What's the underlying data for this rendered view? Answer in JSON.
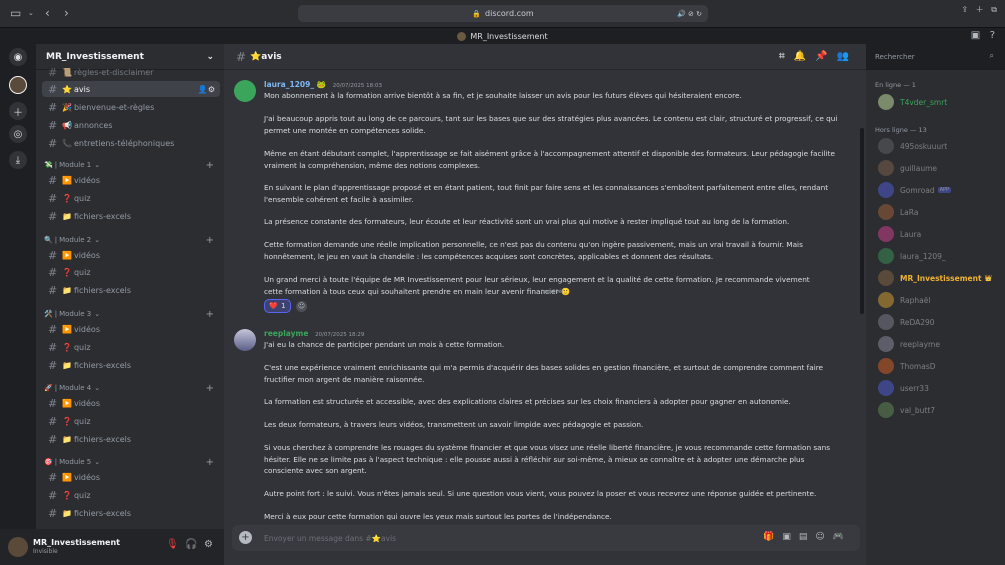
{
  "browser": {
    "url": "discord.com"
  },
  "window_title": "MR_Investissement",
  "sidebar": {
    "guild_name": "MR_Investissement",
    "top_channels": [
      {
        "emoji": "📜",
        "label": "règles-et-disclaimer"
      },
      {
        "emoji": "⭐",
        "label": "avis",
        "active": true
      },
      {
        "emoji": "🎉",
        "label": "bienvenue-et-règles"
      },
      {
        "emoji": "📢",
        "label": "annonces"
      },
      {
        "emoji": "📞",
        "label": "entretiens-téléphoniques"
      }
    ],
    "modules": [
      {
        "emoji": "💸",
        "label": "Module 1",
        "channels": [
          {
            "emoji": "▶️",
            "label": "vidéos"
          },
          {
            "emoji": "❓",
            "label": "quiz"
          },
          {
            "emoji": "📁",
            "label": "fichiers-excels"
          }
        ]
      },
      {
        "emoji": "🔍",
        "label": "Module 2",
        "channels": [
          {
            "emoji": "▶️",
            "label": "vidéos"
          },
          {
            "emoji": "❓",
            "label": "quiz"
          },
          {
            "emoji": "📁",
            "label": "fichiers-excels"
          }
        ]
      },
      {
        "emoji": "🛠️",
        "label": "Module 3",
        "channels": [
          {
            "emoji": "▶️",
            "label": "vidéos"
          },
          {
            "emoji": "❓",
            "label": "quiz"
          },
          {
            "emoji": "📁",
            "label": "fichiers-excels"
          }
        ]
      },
      {
        "emoji": "🚀",
        "label": "Module 4",
        "channels": [
          {
            "emoji": "▶️",
            "label": "vidéos"
          },
          {
            "emoji": "❓",
            "label": "quiz"
          },
          {
            "emoji": "📁",
            "label": "fichiers-excels"
          }
        ]
      },
      {
        "emoji": "🎯",
        "label": "Module 5",
        "channels": [
          {
            "emoji": "▶️",
            "label": "vidéos"
          },
          {
            "emoji": "❓",
            "label": "quiz"
          },
          {
            "emoji": "📁",
            "label": "fichiers-excels"
          }
        ]
      }
    ]
  },
  "user_panel": {
    "name": "MR_Investissement",
    "status": "Invisible"
  },
  "chat": {
    "channel_name": "⭐avis",
    "search_placeholder": "Rechercher",
    "messages": [
      {
        "author": "laura_1209_",
        "badge": "🐸",
        "timestamp": "20/07/2025 18:03",
        "author_color": "#7fb8f5",
        "paragraphs": [
          "Mon abonnement à la formation arrive bientôt à sa fin, et je souhaite laisser un avis pour les futurs élèves qui hésiteraient encore.",
          "J'ai beaucoup appris tout au long de ce parcours, tant sur les bases que sur des stratégies plus avancées. Le contenu est clair, structuré et progressif, ce qui permet une montée en compétences solide.",
          "Même en étant débutant complet, l'apprentissage se fait aisément grâce à l'accompagnement attentif et disponible des formateurs. Leur pédagogie facilite vraiment la compréhension, même des notions complexes.",
          "En suivant le plan d'apprentissage proposé et en étant patient, tout finit par faire sens et les connaissances s'emboîtent parfaitement entre elles, rendant l'ensemble cohérent et facile à assimiler.",
          "La présence constante des formateurs, leur écoute et leur réactivité sont un vrai plus qui motive à rester impliqué tout au long de la formation.",
          "Cette formation demande une réelle implication personnelle, ce n'est pas du contenu qu'on ingère passivement, mais un vrai travail à fournir. Mais honnêtement, le jeu en vaut la chandelle : les compétences acquises sont concrètes, applicables et donnent des résultats.",
          "Un grand merci à toute l'équipe de MR Investissement pour leur sérieux, leur engagement et la qualité de cette formation. Je recommande vivement cette formation à tous ceux qui souhaitent prendre en main leur avenir financier 🙂"
        ],
        "edited_label": "(modifié)",
        "reaction": {
          "emoji": "❤️",
          "count": "1"
        }
      },
      {
        "author": "reeplayme",
        "timestamp": "20/07/2025 18:29",
        "author_color": "#3ba55c",
        "paragraphs": [
          "J'ai eu la chance de participer pendant un mois à cette formation.",
          "C'est une expérience vraiment enrichissante qui m'a permis d'acquérir des bases solides en gestion financière, et surtout de comprendre comment faire fructifier mon argent de manière raisonnée.",
          "La formation est structurée et accessible, avec des explications claires et précises sur les choix financiers à adopter pour gagner en autonomie.",
          "Les deux formateurs, à travers leurs vidéos, transmettent un savoir limpide avec pédagogie et passion.",
          "Si vous cherchez à comprendre les rouages du système financier et que vous visez une réelle liberté financière, je vous recommande cette formation sans hésiter. Elle ne se limite pas à l'aspect technique : elle pousse aussi à réfléchir sur soi-même, à mieux se connaître et à adopter une démarche plus consciente avec son argent.",
          "Autre point fort : le suivi. Vous n'êtes jamais seul. Si une question vous vient, vous pouvez la poser et vous recevrez une réponse guidée et pertinente.",
          "Merci à eux pour cette formation qui ouvre les yeux mais surtout les portes de l'indépendance."
        ]
      }
    ],
    "composer_placeholder": "Envoyer un message dans #⭐avis"
  },
  "members": {
    "online_header": "En ligne — 1",
    "offline_header": "Hors ligne — 13",
    "online": [
      {
        "name": "T4vder_smrt",
        "color": "#3ba55c"
      }
    ],
    "offline": [
      {
        "name": "495oskuuurt",
        "color": "#b5bac1"
      },
      {
        "name": "guillaume",
        "color": "#b5bac1"
      },
      {
        "name": "Gomroad",
        "color": "#b5bac1",
        "tag": "APP"
      },
      {
        "name": "LaRa",
        "color": "#b5bac1"
      },
      {
        "name": "Laura",
        "color": "#b5bac1"
      },
      {
        "name": "laura_1209_",
        "color": "#b5bac1"
      },
      {
        "name": "MR_Investissement",
        "color": "#f0b232",
        "crown": "👑"
      },
      {
        "name": "Raphaël",
        "color": "#b5bac1"
      },
      {
        "name": "ReDA290",
        "color": "#b5bac1"
      },
      {
        "name": "reeplayme",
        "color": "#b5bac1"
      },
      {
        "name": "ThomasD",
        "color": "#b5bac1"
      },
      {
        "name": "userr33",
        "color": "#b5bac1"
      },
      {
        "name": "val_butt7",
        "color": "#b5bac1"
      }
    ]
  }
}
